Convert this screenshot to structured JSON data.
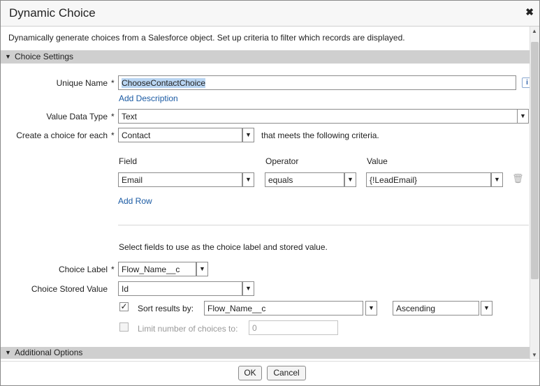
{
  "dialog": {
    "title": "Dynamic Choice",
    "close_glyph": "✖",
    "description": "Dynamically generate choices from a Salesforce object. Set up criteria to filter which records are displayed."
  },
  "sections": {
    "choice_settings": "Choice Settings",
    "additional_options": "Additional Options"
  },
  "form": {
    "unique_name_label": "Unique Name",
    "unique_name_value": "ChooseContactChoice",
    "add_description": "Add Description",
    "info_glyph": "i",
    "value_data_type_label": "Value Data Type",
    "value_data_type_value": "Text",
    "create_choice_label": "Create a choice for each",
    "object_value": "Contact",
    "criteria_suffix": "that meets the following criteria.",
    "required_marker": "*"
  },
  "criteria": {
    "field_header": "Field",
    "operator_header": "Operator",
    "value_header": "Value",
    "rows": [
      {
        "field": "Email",
        "operator": "equals",
        "value": "{!LeadEmail}"
      }
    ],
    "add_row": "Add Row"
  },
  "choice_fields": {
    "instruction": "Select fields to use as the choice label and stored value.",
    "label_label": "Choice Label",
    "label_value": "Flow_Name__c",
    "stored_label": "Choice Stored Value",
    "stored_value": "Id",
    "sort_label": "Sort results by:",
    "sort_checked": true,
    "sort_field": "Flow_Name__c",
    "sort_order": "Ascending",
    "limit_label": "Limit number of choices to:",
    "limit_checked": false,
    "limit_value": "0"
  },
  "footer": {
    "ok": "OK",
    "cancel": "Cancel"
  },
  "colors": {
    "required": "#c23934",
    "link": "#1a5aa3",
    "section_header_bg": "#cfcfcf",
    "selection": "#b9d5f2"
  }
}
